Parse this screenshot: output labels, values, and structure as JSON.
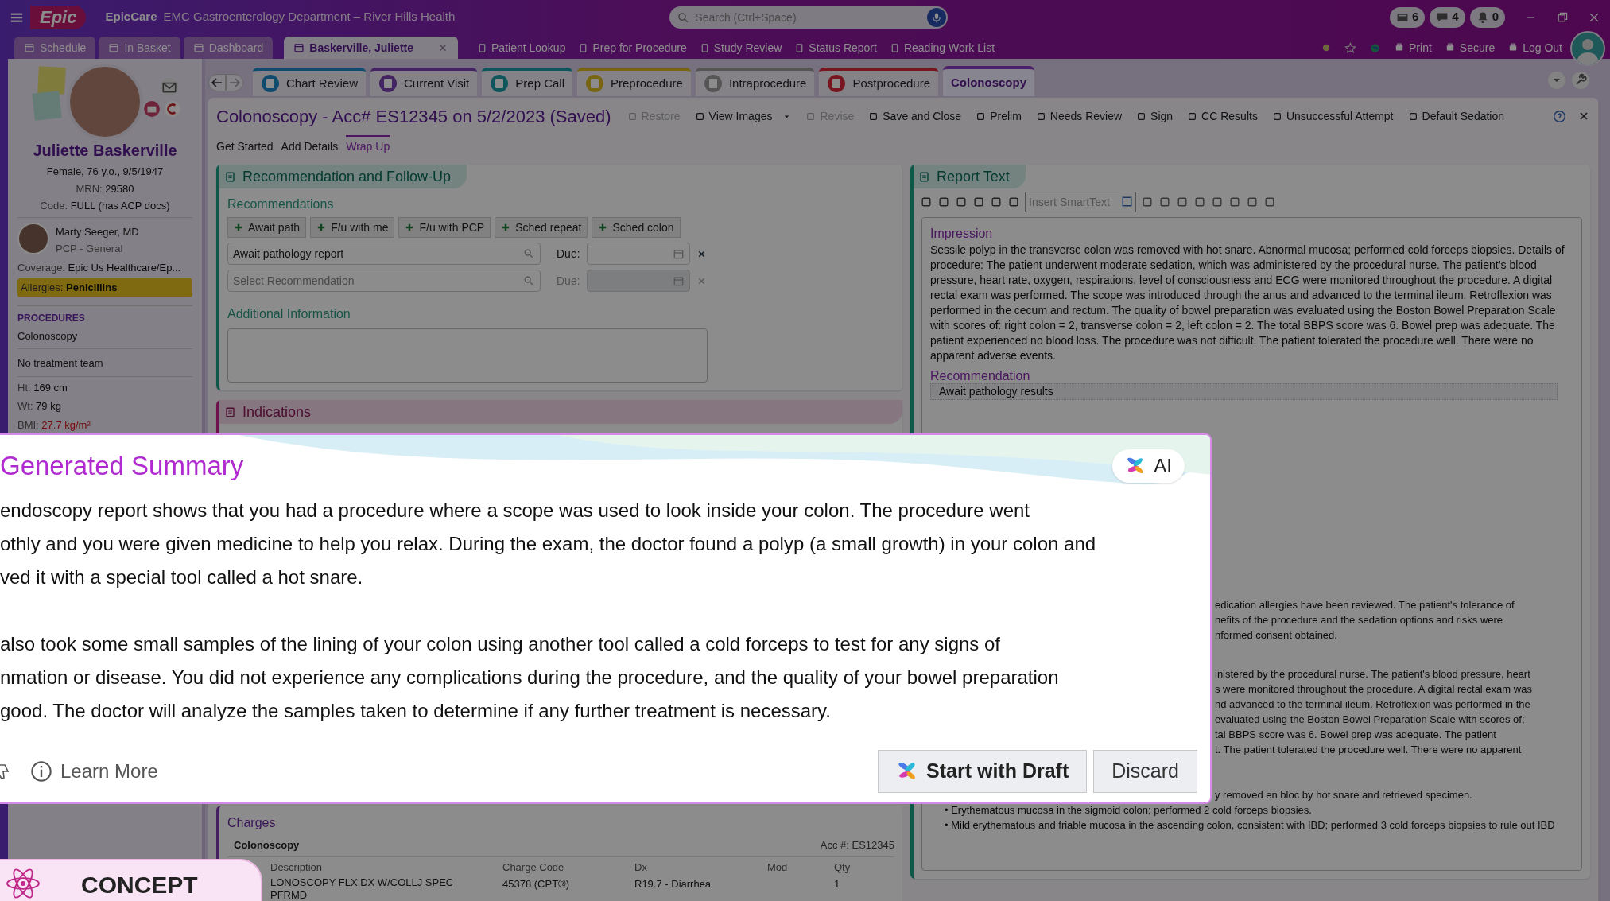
{
  "top_bar": {
    "logo": "Epic",
    "app": "EpicCare",
    "department": "EMC Gastroenterology Department – River Hills Health",
    "search": {
      "placeholder": "Search (Ctrl+Space)"
    },
    "counters": [
      "6",
      "4",
      "0"
    ]
  },
  "nav_tabs": [
    {
      "label": "Schedule",
      "selected": false,
      "closable": false
    },
    {
      "label": "In Basket",
      "selected": false,
      "closable": false
    },
    {
      "label": "Dashboard",
      "selected": false,
      "closable": false
    },
    {
      "label": "Baskerville, Juliette",
      "selected": true,
      "closable": true
    }
  ],
  "nav_links": [
    "Patient Lookup",
    "Prep for Procedure",
    "Study Review",
    "Status Report",
    "Reading Work List"
  ],
  "utility_links": [
    "Print",
    "Secure",
    "Log Out"
  ],
  "patient": {
    "name": "Juliette Baskerville",
    "details": [
      "Female, 76 y.o., 9/5/1947"
    ],
    "mrn_label": "MRN:",
    "mrn": "29580",
    "code_label": "Code:",
    "code": "FULL (has ACP docs)",
    "pcp_name": "Marty Seeger, MD",
    "pcp_role": "PCP - General",
    "coverage_label": "Coverage:",
    "coverage": "Epic Us Healthcare/Ep...",
    "allergies_label": "Allergies:",
    "allergies": "Penicillins",
    "procedures_heading": "PROCEDURES",
    "procedure": "Colonoscopy",
    "team": "No treatment team",
    "vitals": [
      {
        "label": "Ht:",
        "value": "169 cm",
        "abnormal": false
      },
      {
        "label": "Wt:",
        "value": "79 kg",
        "abnormal": false
      },
      {
        "label": "BMI:",
        "value": "27.7 kg/m²",
        "abnormal": true
      }
    ]
  },
  "activity_tabs": [
    {
      "label": "Chart Review",
      "color": "#104b6e",
      "selected": false
    },
    {
      "label": "Current Visit",
      "color": "#442361",
      "selected": false
    },
    {
      "label": "Prep Call",
      "color": "#0e555c",
      "selected": false
    },
    {
      "label": "Preprocedure",
      "color": "#776512",
      "selected": false
    },
    {
      "label": "Intraprocedure",
      "color": "#555555",
      "selected": false
    },
    {
      "label": "Postprocedure",
      "color": "#771621",
      "selected": false
    },
    {
      "label": "Colonoscopy",
      "color": "#4c2069",
      "selected": true
    }
  ],
  "report_header": {
    "title": "Colonoscopy - Acc# ES12345 on 5/2/2023 (Saved)",
    "actions": [
      {
        "label": "Restore",
        "disabled": true,
        "dropdown": false
      },
      {
        "label": "View Images",
        "disabled": false,
        "dropdown": true
      },
      {
        "label": "Revise",
        "disabled": true,
        "dropdown": false
      },
      {
        "label": "Save and Close",
        "disabled": false,
        "dropdown": false
      },
      {
        "label": "Prelim",
        "disabled": false,
        "dropdown": false
      },
      {
        "label": "Needs Review",
        "disabled": false,
        "dropdown": false
      },
      {
        "label": "Sign",
        "disabled": false,
        "dropdown": false
      },
      {
        "label": "CC Results",
        "disabled": false,
        "dropdown": false
      },
      {
        "label": "Unsuccessful Attempt",
        "disabled": false,
        "dropdown": false
      },
      {
        "label": "Default Sedation",
        "disabled": false,
        "dropdown": false
      }
    ]
  },
  "steps": [
    {
      "label": "Get Started",
      "selected": false
    },
    {
      "label": "Add Details",
      "selected": false
    },
    {
      "label": "Wrap Up",
      "selected": true
    }
  ],
  "recommendation_panel": {
    "title": "Recommendation and Follow-Up",
    "subheading": "Recommendations",
    "quick_buttons": [
      "Await path",
      "F/u with me",
      "F/u with PCP",
      "Sched repeat",
      "Sched colon"
    ],
    "rows": [
      {
        "value": "Await pathology report",
        "due_label": "Due:",
        "disabled": false
      },
      {
        "placeholder": "Select Recommendation",
        "due_label": "Due:",
        "disabled": true
      }
    ],
    "additional_label": "Additional Information"
  },
  "indications_panel": {
    "title": "Indications"
  },
  "charges": {
    "title": "Charges",
    "procedure": "Colonoscopy",
    "acc": "Acc #: ES12345",
    "columns": [
      "Description",
      "Charge Code",
      "Dx",
      "Mod",
      "Qty"
    ],
    "rows": [
      {
        "description": [
          "LONOSCOPY FLX DX W/COLLJ SPEC",
          "PFRMD"
        ],
        "charge_code": "45378 (CPT®)",
        "dx": "R19.7 - Diarrhea",
        "qty": "1"
      }
    ]
  },
  "report_text": {
    "title": "Report Text",
    "smarttext_placeholder": "Insert SmartText",
    "sections": [
      {
        "heading": "Impression",
        "text": "Sessile polyp in the transverse colon was removed with hot snare. Abnormal mucosa; performed cold forceps biopsies. Details of procedure: The patient underwent moderate sedation, which was administered by the procedural nurse. The patient’s blood pressure, heart rate, oxygen, respirations, level of consciousness and ECG were monitored throughout the procedure. A digital rectal exam was performed. The scope was introduced through the anus and advanced to the terminal ileum. Retroflexion was performed in the cecum and rectum. The quality of bowel preparation was evaluated using the Boston Bowel Preparation Scale with scores of: right colon = 2, transverse colon = 2, left colon = 2. The total BBPS score was 6. Bowel prep was adequate. The patient experienced no blood loss. The procedure was not difficult. The patient tolerated the procedure well. There were no apparent adverse events."
      },
      {
        "heading": "Recommendation",
        "text": "Await pathology results"
      }
    ],
    "partial_blocks": [
      [
        "edication allergies have been reviewed. The patient's tolerance of",
        "nefits of the procedure and the sedation options and risks were",
        "nformed consent obtained."
      ],
      [
        "inistered by the procedural nurse. The patient's blood pressure, heart",
        "s were monitored throughout the procedure. A digital rectal exam was",
        "nd advanced to the terminal ileum. Retroflexion was performed in the",
        "evaluated using the Boston Bowel Preparation Scale with scores of;",
        "tal BBPS score was 6. Bowel prep was adequate. The patient",
        "t. The patient tolerated the procedure well. There were no apparent"
      ],
      [
        "y removed en bloc by hot snare and retrieved specimen."
      ]
    ],
    "bullets": [
      "• Erythematous mucosa in the sigmoid colon; performed 2 cold forceps biopsies.",
      "• Mild erythematous and friable mucosa in the ascending colon, consistent with IBD; performed 3 cold forceps biopsies to rule out IBD"
    ]
  },
  "ai_summary": {
    "title": "Generated Summary",
    "badge": "AI",
    "paragraphs": [
      [
        "endoscopy report shows that you had a procedure where a scope was used to look inside your colon. The procedure went",
        "othly and you were given medicine to help you relax. During the exam, the doctor found a polyp (a small growth) in your colon and",
        "ved it with a special tool called a hot snare."
      ],
      [
        "also took some small samples of the lining of your colon using another tool called a cold forceps to test for any signs of",
        "nmation or disease. You did not experience any complications during the procedure, and the quality of your bowel preparation",
        "good. The doctor will analyze the samples taken to determine if any further treatment is necessary."
      ]
    ],
    "learn_more": "Learn More",
    "primary_button": "Start with Draft",
    "secondary_button": "Discard"
  },
  "concept_badge": "CONCEPT"
}
